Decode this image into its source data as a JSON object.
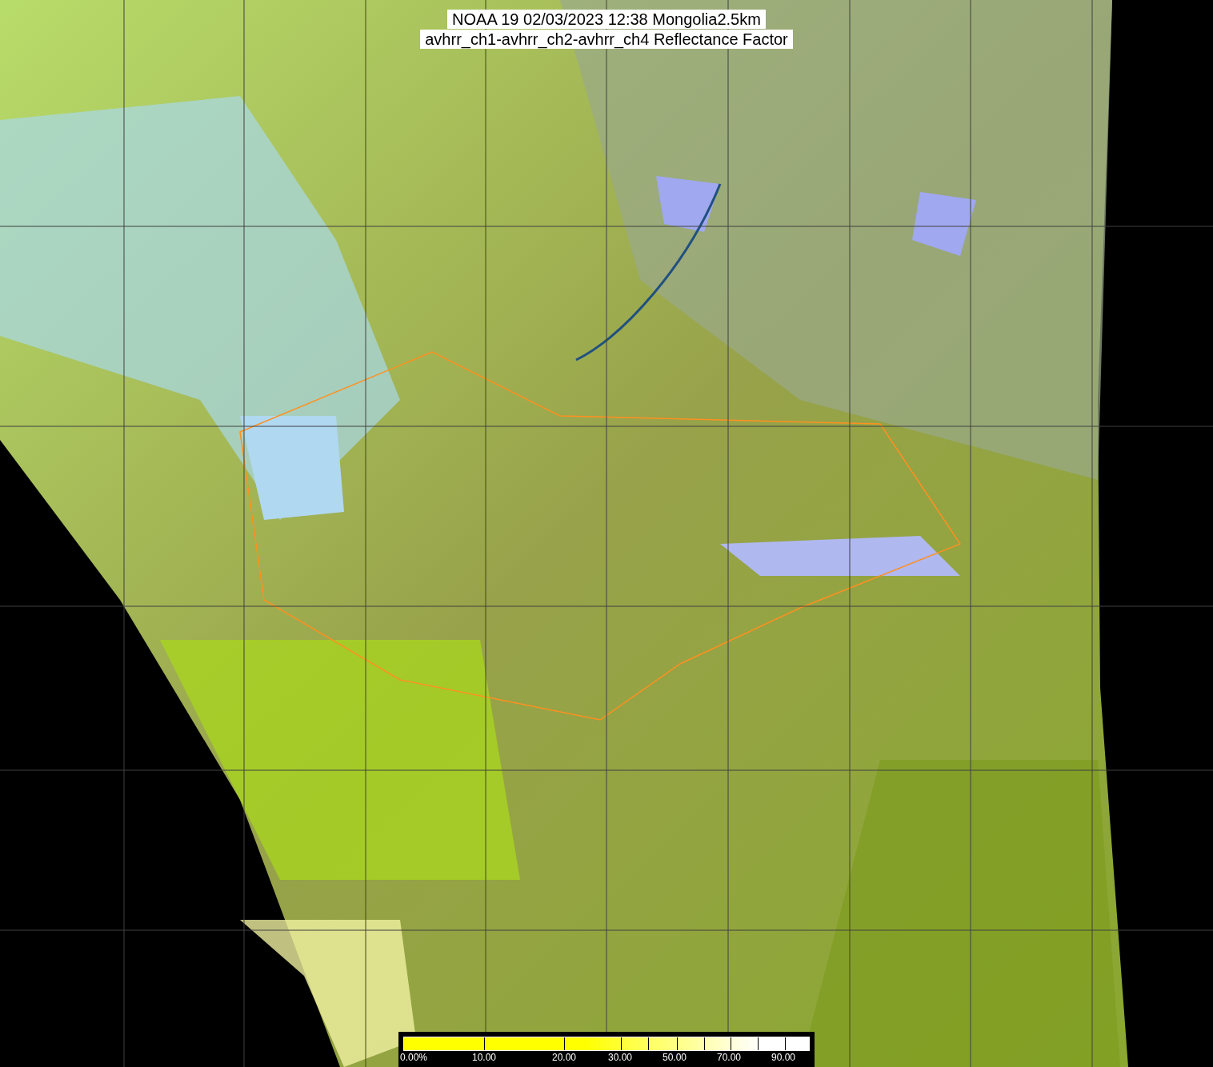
{
  "title": {
    "lines": [
      "NOAA 19 02/03/2023 12:38 Mongolia2.5km",
      "avhrr_ch1-avhrr_ch2-avhrr_ch4 Reflectance Factor"
    ]
  },
  "colorbar": {
    "labels": [
      "0.00%",
      "10.00",
      "20.00",
      "30.00",
      "50.00",
      "70.00",
      "90.00"
    ]
  }
}
